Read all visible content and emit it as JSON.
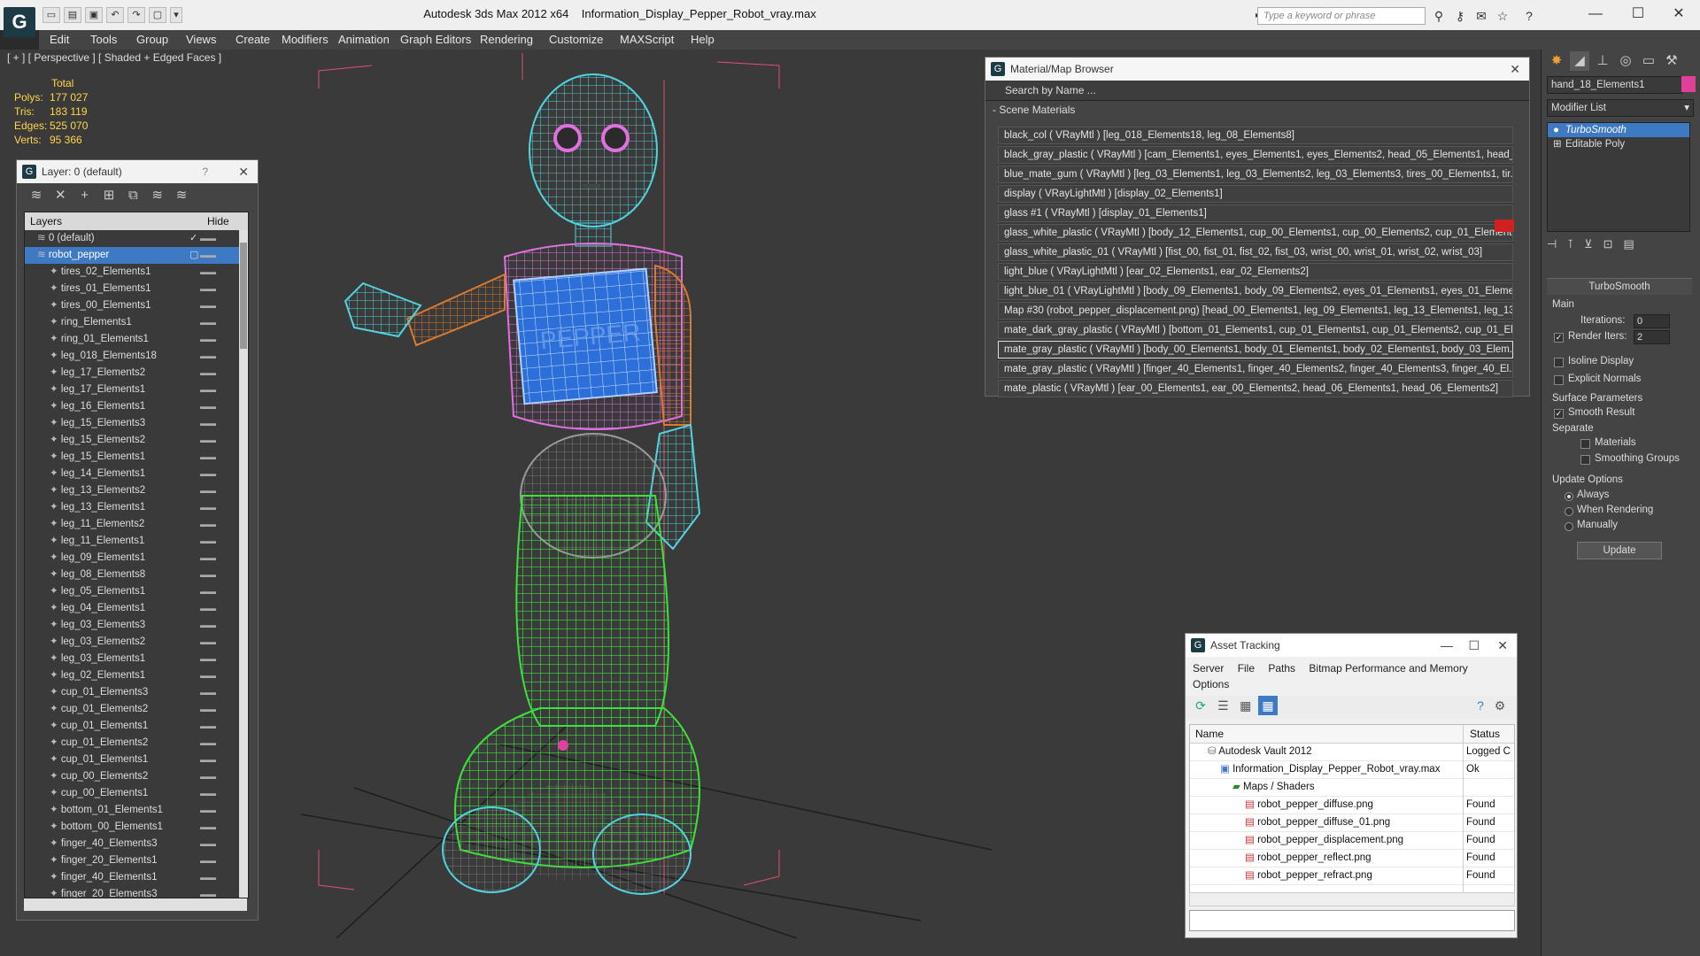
{
  "window": {
    "app_title": "Autodesk 3ds Max  2012 x64",
    "file_title": "Information_Display_Pepper_Robot_vray.max",
    "search_placeholder": "Type a keyword or phrase"
  },
  "menubar": [
    "Edit",
    "Tools",
    "Group",
    "Views",
    "Create",
    "Modifiers",
    "Animation",
    "Graph Editors",
    "Rendering",
    "Customize",
    "MAXScript",
    "Help"
  ],
  "viewport": {
    "label": "[ + ] [ Perspective ] [ Shaded + Edged Faces ]",
    "stats": {
      "header": "Total",
      "rows": [
        {
          "label": "Polys:",
          "value": "177 027"
        },
        {
          "label": "Tris:",
          "value": "183 119"
        },
        {
          "label": "Edges:",
          "value": "525 070"
        },
        {
          "label": "Verts:",
          "value": "95 366"
        }
      ]
    },
    "screen_text": "PEPPER"
  },
  "layer_panel": {
    "title": "Layer: 0 (default)",
    "help": "?",
    "col_layers": "Layers",
    "col_hide": "Hide",
    "layers": [
      "0 (default)",
      "robot_pepper",
      "tires_02_Elements1",
      "tires_01_Elements1",
      "tires_00_Elements1",
      "ring_Elements1",
      "ring_01_Elements1",
      "leg_018_Elements18",
      "leg_17_Elements2",
      "leg_17_Elements1",
      "leg_16_Elements1",
      "leg_15_Elements3",
      "leg_15_Elements2",
      "leg_15_Elements1",
      "leg_14_Elements1",
      "leg_13_Elements2",
      "leg_13_Elements1",
      "leg_11_Elements2",
      "leg_11_Elements1",
      "leg_09_Elements1",
      "leg_08_Elements8",
      "leg_05_Elements1",
      "leg_04_Elements1",
      "leg_03_Elements3",
      "leg_03_Elements2",
      "leg_03_Elements1",
      "leg_02_Elements1",
      "cup_01_Elements3",
      "cup_01_Elements2",
      "cup_01_Elements1",
      "cup_01_Elements2",
      "cup_01_Elements1",
      "cup_00_Elements2",
      "cup_00_Elements1",
      "bottom_01_Elements1",
      "bottom_00_Elements1",
      "finger_40_Elements3",
      "finger_20_Elements1",
      "finger_40_Elements1",
      "finger_20_Elements3"
    ]
  },
  "material_browser": {
    "title": "Material/Map Browser",
    "search_placeholder": "Search by Name ...",
    "section": "- Scene Materials",
    "materials": [
      "black_col  ( VRayMtl )  [leg_018_Elements18, leg_08_Elements8]",
      "black_gray_plastic  ( VRayMtl )  [cam_Elements1, eyes_Elements1, eyes_Elements2, head_05_Elements1, head_...",
      "blue_mate_gum  ( VRayMtl )  [leg_03_Elements1, leg_03_Elements2, leg_03_Elements3, tires_00_Elements1, tir...",
      "display  ( VRayLightMtl )  [display_02_Elements1]",
      "glass #1  ( VRayMtl )  [display_01_Elements1]",
      "glass_white_plastic  ( VRayMtl )  [body_12_Elements1, cup_00_Elements1, cup_00_Elements2, cup_01_Element...",
      "glass_white_plastic_01  ( VRayMtl )  [fist_00, fist_01, fist_02, fist_03, wrist_00, wrist_01, wrist_02, wrist_03]",
      "light_blue  ( VRayLightMtl )  [ear_02_Elements1, ear_02_Elements2]",
      "light_blue_01  ( VRayLightMtl )  [body_09_Elements1, body_09_Elements2, eyes_01_Elements1, eyes_01_Eleme...",
      "Map #30 (robot_pepper_displacement.png)  [head_00_Elements1, leg_09_Elements1, leg_13_Elements1, leg_13...",
      "mate_dark_gray_plastic  ( VRayMtl )  [bottom_01_Elements1, cup_01_Elements1, cup_01_Elements2, cup_01_El...",
      "mate_gray_plastic  ( VRayMtl )  [body_00_Elements1, body_01_Elements1, body_02_Elements1, body_03_Elem...",
      "mate_gray_plastic  ( VRayMtl )  [finger_40_Elements1, finger_40_Elements2, finger_40_Elements3, finger_40_El...",
      "mate_plastic  ( VRayMtl )  [ear_00_Elements1, ear_00_Elements2, head_06_Elements1, head_06_Elements2]"
    ]
  },
  "asset_tracking": {
    "title": "Asset Tracking",
    "menu": [
      "Server",
      "File",
      "Paths",
      "Bitmap Performance and Memory",
      "Options"
    ],
    "col_name": "Name",
    "col_status": "Status",
    "rows": [
      {
        "name": "Autodesk Vault 2012",
        "status": "Logged C",
        "indent": 0
      },
      {
        "name": "Information_Display_Pepper_Robot_vray.max",
        "status": "Ok",
        "indent": 1
      },
      {
        "name": "Maps / Shaders",
        "status": "",
        "indent": 2
      },
      {
        "name": "robot_pepper_diffuse.png",
        "status": "Found",
        "indent": 3
      },
      {
        "name": "robot_pepper_diffuse_01.png",
        "status": "Found",
        "indent": 3
      },
      {
        "name": "robot_pepper_displacement.png",
        "status": "Found",
        "indent": 3
      },
      {
        "name": "robot_pepper_reflect.png",
        "status": "Found",
        "indent": 3
      },
      {
        "name": "robot_pepper_refract.png",
        "status": "Found",
        "indent": 3
      }
    ]
  },
  "command_panel": {
    "object_name": "hand_18_Elements1",
    "object_color": "#e0409a",
    "modifier_list": "Modifier List",
    "stack": [
      "TurboSmooth",
      "Editable Poly"
    ],
    "rollout_title": "TurboSmooth",
    "main": "Main",
    "iterations_label": "Iterations:",
    "iterations_value": "0",
    "render_iters_label": "Render Iters:",
    "render_iters_value": "2",
    "isoline_label": "Isoline Display",
    "explicit_label": "Explicit Normals",
    "surface_params": "Surface Parameters",
    "smooth_result": "Smooth Result",
    "separate": "Separate",
    "materials": "Materials",
    "smoothing_groups": "Smoothing Groups",
    "update_options": "Update Options",
    "always": "Always",
    "when_rendering": "When Rendering",
    "manually": "Manually",
    "update_button": "Update"
  },
  "colors": {
    "selection": "#3e79c4",
    "wire_green": "#3de03d",
    "wire_cyan": "#4fd4e0",
    "wire_pink": "#e070e0",
    "wire_orange": "#d97a30",
    "screen_blue": "#2d6fd8"
  }
}
